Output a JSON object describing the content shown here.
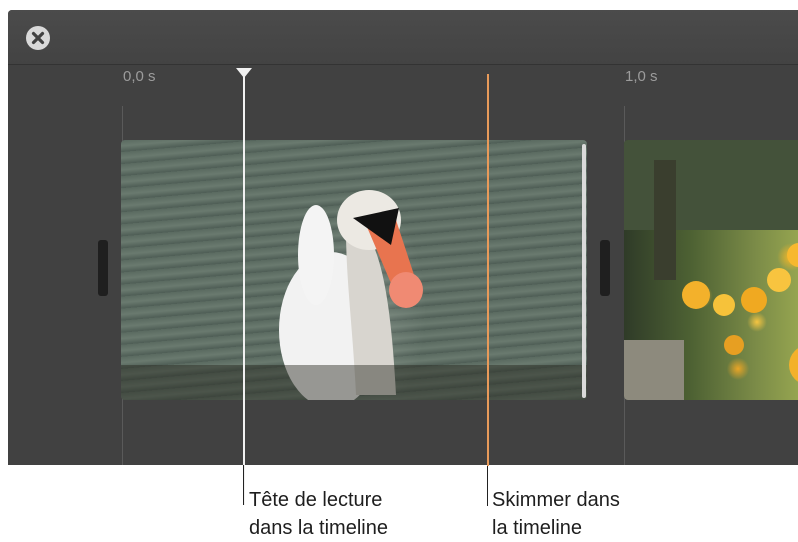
{
  "toolbar": {
    "close_icon": "close-icon",
    "colors": {
      "panel": "#414141",
      "close_button": "#d9d9d9"
    }
  },
  "timeline": {
    "ruler_labels": [
      "0,0 s",
      "1,0 s"
    ],
    "playhead_color": "#f1f1f1",
    "skimmer_color": "#e89a5a",
    "clips": [
      {
        "name": "swan"
      },
      {
        "name": "flowers"
      }
    ]
  },
  "callouts": {
    "playhead": {
      "line1": "Tête de lecture",
      "line2": "dans la timeline"
    },
    "skimmer": {
      "line1": "Skimmer dans",
      "line2": "la timeline"
    }
  }
}
